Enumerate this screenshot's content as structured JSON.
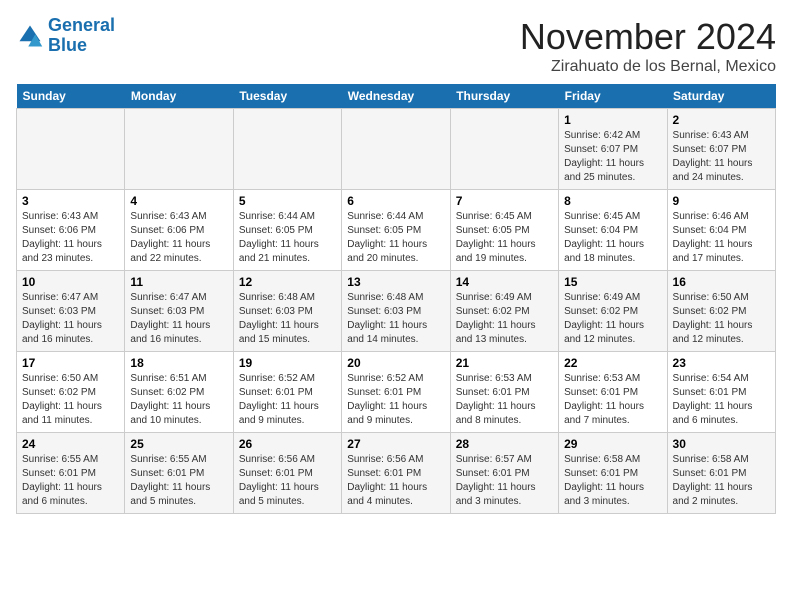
{
  "logo": {
    "line1": "General",
    "line2": "Blue"
  },
  "header": {
    "month": "November 2024",
    "location": "Zirahuato de los Bernal, Mexico"
  },
  "weekdays": [
    "Sunday",
    "Monday",
    "Tuesday",
    "Wednesday",
    "Thursday",
    "Friday",
    "Saturday"
  ],
  "weeks": [
    [
      {
        "day": "",
        "detail": ""
      },
      {
        "day": "",
        "detail": ""
      },
      {
        "day": "",
        "detail": ""
      },
      {
        "day": "",
        "detail": ""
      },
      {
        "day": "",
        "detail": ""
      },
      {
        "day": "1",
        "detail": "Sunrise: 6:42 AM\nSunset: 6:07 PM\nDaylight: 11 hours and 25 minutes."
      },
      {
        "day": "2",
        "detail": "Sunrise: 6:43 AM\nSunset: 6:07 PM\nDaylight: 11 hours and 24 minutes."
      }
    ],
    [
      {
        "day": "3",
        "detail": "Sunrise: 6:43 AM\nSunset: 6:06 PM\nDaylight: 11 hours and 23 minutes."
      },
      {
        "day": "4",
        "detail": "Sunrise: 6:43 AM\nSunset: 6:06 PM\nDaylight: 11 hours and 22 minutes."
      },
      {
        "day": "5",
        "detail": "Sunrise: 6:44 AM\nSunset: 6:05 PM\nDaylight: 11 hours and 21 minutes."
      },
      {
        "day": "6",
        "detail": "Sunrise: 6:44 AM\nSunset: 6:05 PM\nDaylight: 11 hours and 20 minutes."
      },
      {
        "day": "7",
        "detail": "Sunrise: 6:45 AM\nSunset: 6:05 PM\nDaylight: 11 hours and 19 minutes."
      },
      {
        "day": "8",
        "detail": "Sunrise: 6:45 AM\nSunset: 6:04 PM\nDaylight: 11 hours and 18 minutes."
      },
      {
        "day": "9",
        "detail": "Sunrise: 6:46 AM\nSunset: 6:04 PM\nDaylight: 11 hours and 17 minutes."
      }
    ],
    [
      {
        "day": "10",
        "detail": "Sunrise: 6:47 AM\nSunset: 6:03 PM\nDaylight: 11 hours and 16 minutes."
      },
      {
        "day": "11",
        "detail": "Sunrise: 6:47 AM\nSunset: 6:03 PM\nDaylight: 11 hours and 16 minutes."
      },
      {
        "day": "12",
        "detail": "Sunrise: 6:48 AM\nSunset: 6:03 PM\nDaylight: 11 hours and 15 minutes."
      },
      {
        "day": "13",
        "detail": "Sunrise: 6:48 AM\nSunset: 6:03 PM\nDaylight: 11 hours and 14 minutes."
      },
      {
        "day": "14",
        "detail": "Sunrise: 6:49 AM\nSunset: 6:02 PM\nDaylight: 11 hours and 13 minutes."
      },
      {
        "day": "15",
        "detail": "Sunrise: 6:49 AM\nSunset: 6:02 PM\nDaylight: 11 hours and 12 minutes."
      },
      {
        "day": "16",
        "detail": "Sunrise: 6:50 AM\nSunset: 6:02 PM\nDaylight: 11 hours and 12 minutes."
      }
    ],
    [
      {
        "day": "17",
        "detail": "Sunrise: 6:50 AM\nSunset: 6:02 PM\nDaylight: 11 hours and 11 minutes."
      },
      {
        "day": "18",
        "detail": "Sunrise: 6:51 AM\nSunset: 6:02 PM\nDaylight: 11 hours and 10 minutes."
      },
      {
        "day": "19",
        "detail": "Sunrise: 6:52 AM\nSunset: 6:01 PM\nDaylight: 11 hours and 9 minutes."
      },
      {
        "day": "20",
        "detail": "Sunrise: 6:52 AM\nSunset: 6:01 PM\nDaylight: 11 hours and 9 minutes."
      },
      {
        "day": "21",
        "detail": "Sunrise: 6:53 AM\nSunset: 6:01 PM\nDaylight: 11 hours and 8 minutes."
      },
      {
        "day": "22",
        "detail": "Sunrise: 6:53 AM\nSunset: 6:01 PM\nDaylight: 11 hours and 7 minutes."
      },
      {
        "day": "23",
        "detail": "Sunrise: 6:54 AM\nSunset: 6:01 PM\nDaylight: 11 hours and 6 minutes."
      }
    ],
    [
      {
        "day": "24",
        "detail": "Sunrise: 6:55 AM\nSunset: 6:01 PM\nDaylight: 11 hours and 6 minutes."
      },
      {
        "day": "25",
        "detail": "Sunrise: 6:55 AM\nSunset: 6:01 PM\nDaylight: 11 hours and 5 minutes."
      },
      {
        "day": "26",
        "detail": "Sunrise: 6:56 AM\nSunset: 6:01 PM\nDaylight: 11 hours and 5 minutes."
      },
      {
        "day": "27",
        "detail": "Sunrise: 6:56 AM\nSunset: 6:01 PM\nDaylight: 11 hours and 4 minutes."
      },
      {
        "day": "28",
        "detail": "Sunrise: 6:57 AM\nSunset: 6:01 PM\nDaylight: 11 hours and 3 minutes."
      },
      {
        "day": "29",
        "detail": "Sunrise: 6:58 AM\nSunset: 6:01 PM\nDaylight: 11 hours and 3 minutes."
      },
      {
        "day": "30",
        "detail": "Sunrise: 6:58 AM\nSunset: 6:01 PM\nDaylight: 11 hours and 2 minutes."
      }
    ]
  ]
}
